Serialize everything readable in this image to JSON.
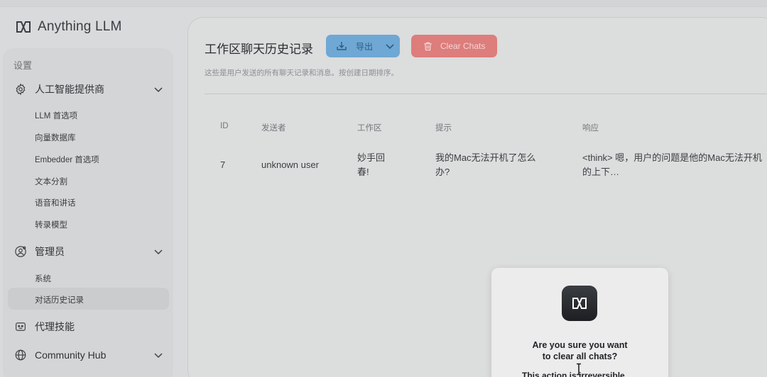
{
  "app": {
    "name": "Anything LLM"
  },
  "sidebar": {
    "section_label": "设置",
    "groups": [
      {
        "label": "人工智能提供商",
        "icon": "gear-icon"
      },
      {
        "label": "管理员",
        "icon": "user-gear-icon"
      },
      {
        "label": "代理技能",
        "icon": "robot-icon"
      },
      {
        "label": "Community Hub",
        "icon": "globe-icon"
      }
    ],
    "ai_items": [
      "LLM 首选项",
      "向量数据库",
      "Embedder 首选项",
      "文本分割",
      "语音和讲话",
      "转录模型"
    ],
    "admin_items": [
      "系统",
      "对话历史记录"
    ],
    "active_item": "对话历史记录"
  },
  "main": {
    "title": "工作区聊天历史记录",
    "export_label": "导出",
    "clear_label": "Clear Chats",
    "subtitle": "这些是用户发送的所有聊天记录和消息。按创建日期排序。",
    "table": {
      "headers": [
        "ID",
        "发送者",
        "工作区",
        "提示",
        "响应"
      ],
      "rows": [
        {
          "id": "7",
          "sender": "unknown user",
          "workspace_l1": "妙手回",
          "workspace_l2": "春!",
          "prompt_l1": "我的Mac无法开机了怎么",
          "prompt_l2": "办?",
          "response_l1": "<think> 嗯，用户的问题是他的Mac无法开机",
          "response_l2": "的上下…"
        }
      ]
    }
  },
  "modal": {
    "title_l1": "Are you sure you want",
    "title_l2": "to clear all chats?",
    "body_partial": "This action is irreversible."
  },
  "colors": {
    "export_button": "#6fa8d4",
    "clear_button": "#dd7d7c",
    "background": "#d9dadb"
  }
}
